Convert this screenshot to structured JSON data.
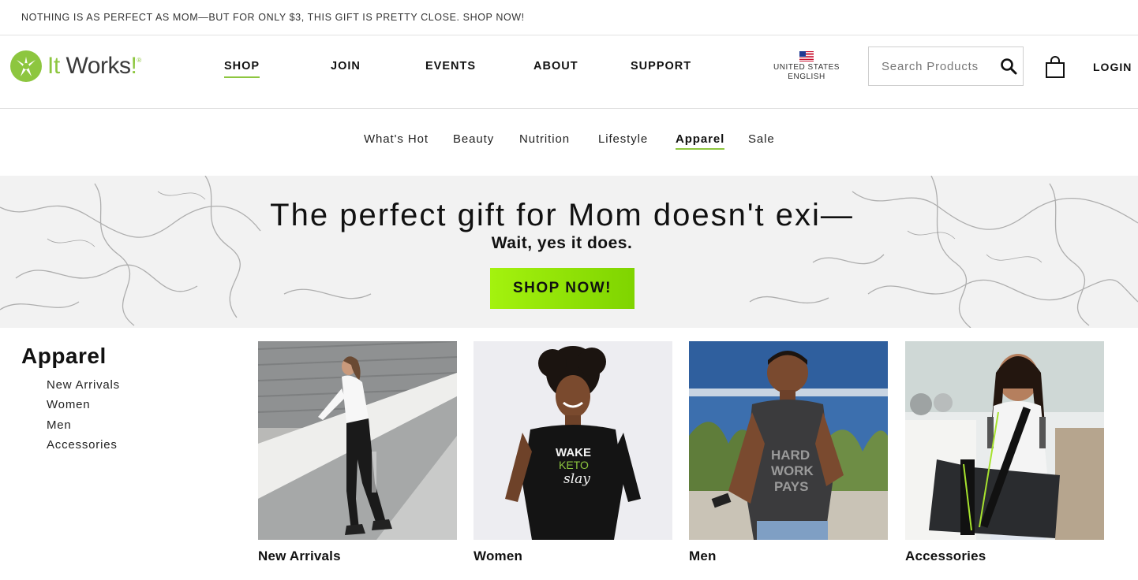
{
  "announcement": "NOTHING IS AS PERFECT AS MOM—BUT FOR ONLY $3, THIS GIFT IS PRETTY CLOSE. SHOP NOW!",
  "brand": {
    "name_it": "It",
    "name_works": " Works",
    "name_bang": "!",
    "reg": "®",
    "accent": "#8dc63f"
  },
  "main_nav": [
    {
      "label": "SHOP",
      "active": true
    },
    {
      "label": "JOIN"
    },
    {
      "label": "EVENTS"
    },
    {
      "label": "ABOUT"
    },
    {
      "label": "SUPPORT"
    }
  ],
  "region": {
    "country": "UNITED STATES",
    "language": "ENGLISH",
    "flag_icon": "us-flag-icon"
  },
  "search": {
    "placeholder": "Search Products",
    "icon": "search-icon"
  },
  "cart_icon": "shopping-bag-icon",
  "login_label": "LOGIN",
  "sub_nav": [
    {
      "label": "What's Hot"
    },
    {
      "label": "Beauty"
    },
    {
      "label": "Nutrition"
    },
    {
      "label": "Lifestyle"
    },
    {
      "label": "Apparel",
      "active": true
    },
    {
      "label": "Sale"
    }
  ],
  "hero": {
    "title": "The perfect gift for Mom doesn't exi—",
    "subtitle": "Wait, yes it does.",
    "button": "SHOP NOW!",
    "button_color": "#8ee400"
  },
  "sidebar": {
    "title": "Apparel",
    "links": [
      "New Arrivals",
      "Women",
      "Men",
      "Accessories"
    ]
  },
  "tiles": [
    {
      "label": "New Arrivals",
      "image": "woman-in-leggings-photo"
    },
    {
      "label": "Women",
      "image": "woman-in-wake-keto-slay-shirt-photo"
    },
    {
      "label": "Men",
      "image": "man-in-hard-work-pays-shirt-photo"
    },
    {
      "label": "Accessories",
      "image": "woman-with-duffel-bag-photo"
    }
  ]
}
